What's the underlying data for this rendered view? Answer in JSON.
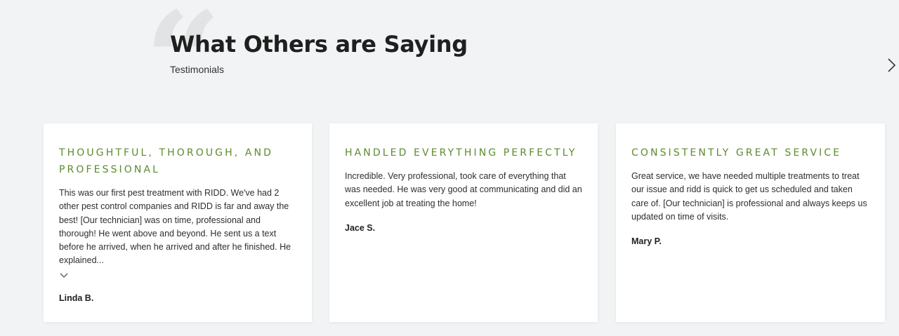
{
  "header": {
    "title": "What Others are Saying",
    "subtitle": "Testimonials",
    "quote_mark": "“"
  },
  "icons": {
    "quote": "quote-mark-icon",
    "next": "chevron-right-icon",
    "expand": "chevron-down-icon"
  },
  "colors": {
    "background": "#f2f3f4",
    "accent": "#5d8a2e",
    "card": "#ffffff"
  },
  "testimonials": [
    {
      "title": "THOUGHTFUL, THOROUGH, AND PROFESSIONAL",
      "body": "This was our first pest treatment with RIDD. We've had 2 other pest control companies and RIDD is far and away the best! [Our technician] was on time, professional and thorough! He went above and beyond. He sent us a text before he arrived, when he arrived and after he finished. He explained...",
      "author": "Linda B.",
      "truncated": true
    },
    {
      "title": "HANDLED EVERYTHING PERFECTLY",
      "body": "Incredible. Very professional, took care of everything that was needed. He was very good at communicating and did an excellent job at treating the home!",
      "author": "Jace S.",
      "truncated": false
    },
    {
      "title": "CONSISTENTLY GREAT SERVICE",
      "body": "Great service, we have needed multiple treatments to treat our issue and ridd is quick to get us scheduled and taken care of. [Our technician] is professional and always keeps us updated on time of visits.",
      "author": "Mary P.",
      "truncated": false
    }
  ]
}
